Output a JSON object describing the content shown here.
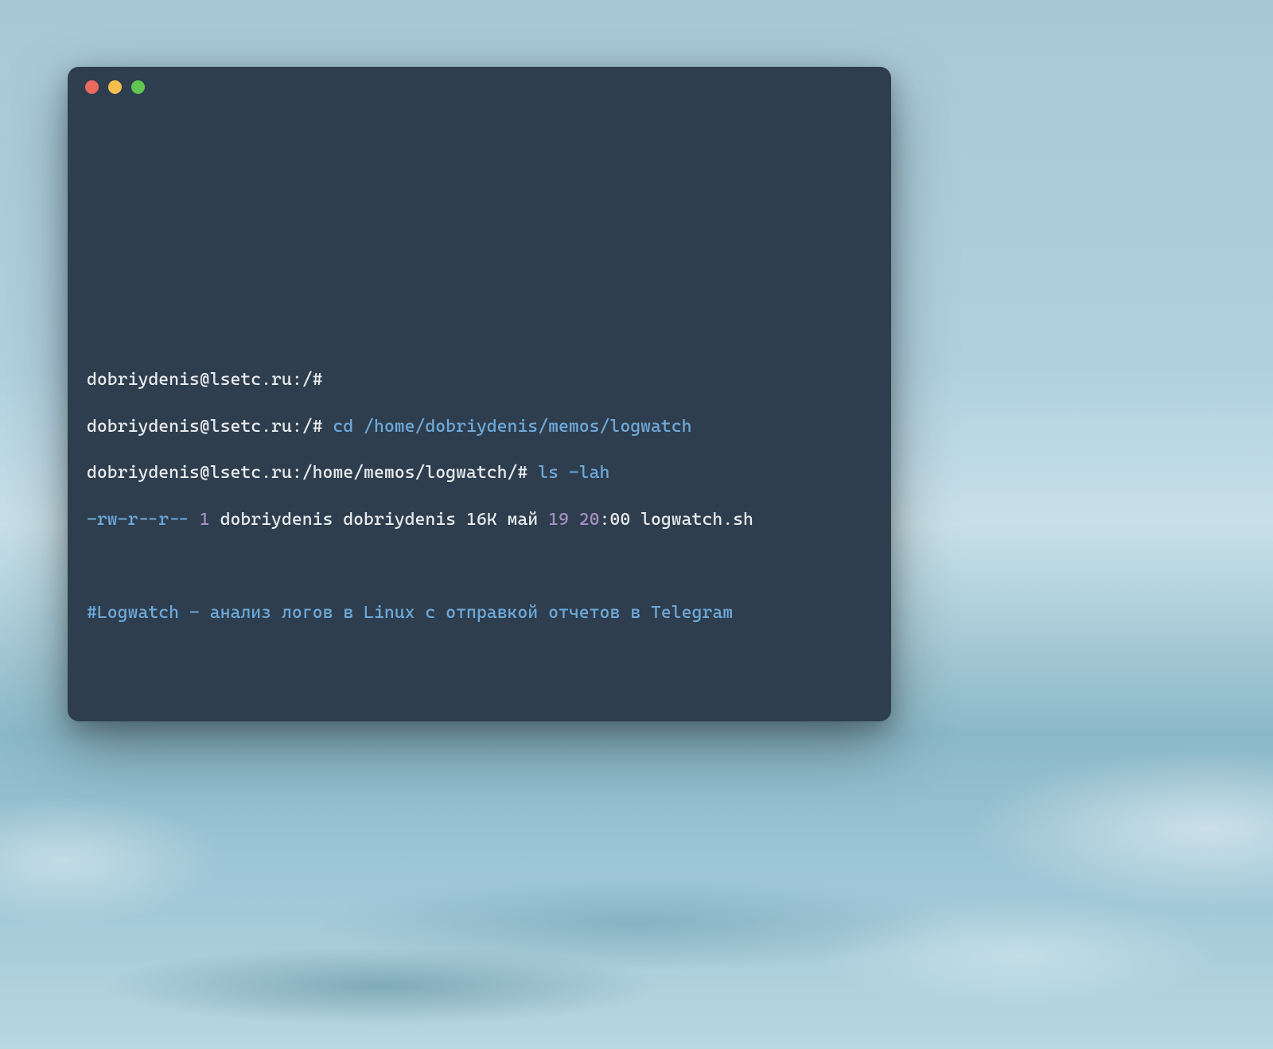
{
  "terminal": {
    "lines": {
      "l1": {
        "prompt": "dobriydenis@lsetc.ru:/#"
      },
      "l2": {
        "prompt": "dobriydenis@lsetc.ru:/# ",
        "cmd": "cd /home/dobriydenis/memos/logwatch"
      },
      "l3": {
        "prompt": "dobriydenis@lsetc.ru:/home/memos/logwatch/# ",
        "cmd": "ls -lah"
      },
      "l4": {
        "perms": "-rw-r--r-- ",
        "links": "1",
        "sp1": " ",
        "owner": "dobriydenis dobriydenis 16K май ",
        "day": "19",
        "sp2": " ",
        "hour": "20",
        "rest": ":00 logwatch.sh"
      },
      "l5": {
        "text": "#Logwatch - анализ логов в Linux с отправкой отчетов в Telegram"
      }
    }
  }
}
